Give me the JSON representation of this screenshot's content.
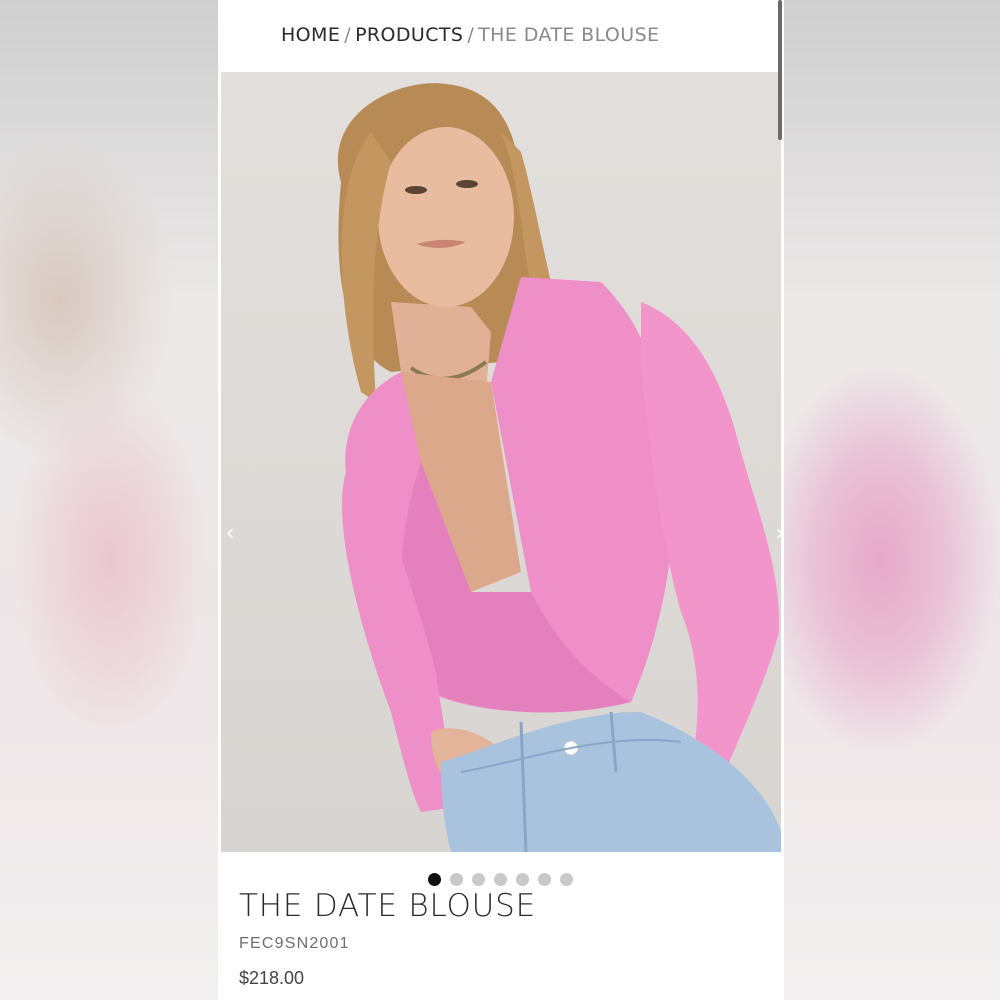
{
  "breadcrumb": {
    "home": "HOME",
    "products": "PRODUCTS",
    "current": "THE DATE BLOUSE",
    "separator": "/"
  },
  "gallery": {
    "image_alt": "THE DATE BLOUSE",
    "prev_icon": "chevron-left-icon",
    "next_icon": "chevron-right-icon",
    "prev_glyph": "‹",
    "next_glyph": "›",
    "slide_count": 7,
    "active_slide": 1
  },
  "product": {
    "title": "THE DATE BLOUSE",
    "sku": "FEC9SN2001",
    "price": "$218.00"
  },
  "colors": {
    "blouse": "#ee8fc7",
    "active_dot": "#111111",
    "inactive_dot": "#c9c9c9"
  }
}
